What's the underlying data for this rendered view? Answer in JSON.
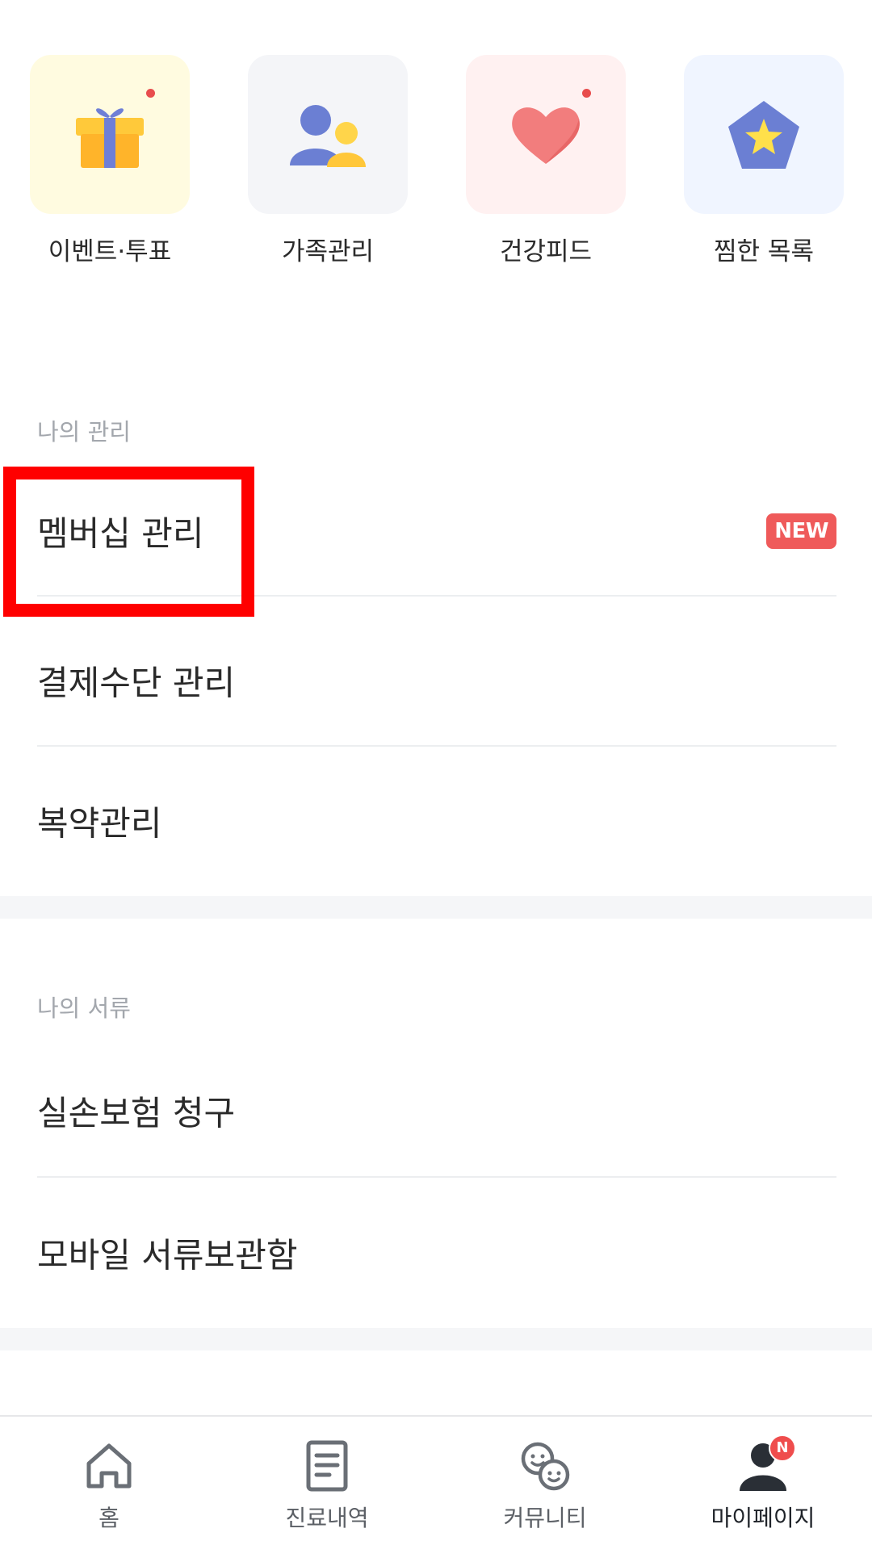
{
  "quick_menu": {
    "items": [
      {
        "label": "이벤트·투표",
        "icon": "gift-icon",
        "tile_color": "#fffbe0",
        "has_dot": true
      },
      {
        "label": "가족관리",
        "icon": "family-icon",
        "tile_color": "#f4f5f8",
        "has_dot": false
      },
      {
        "label": "건강피드",
        "icon": "heart-icon",
        "tile_color": "#fff1f1",
        "has_dot": true
      },
      {
        "label": "찜한 목록",
        "icon": "star-pentagon-icon",
        "tile_color": "#f0f5ff",
        "has_dot": false
      }
    ],
    "dot_color": "#e84d4d"
  },
  "my_management": {
    "section_label": "나의 관리",
    "items": [
      {
        "label": "멤버십 관리",
        "badge": "NEW"
      },
      {
        "label": "결제수단 관리"
      },
      {
        "label": "복약관리"
      }
    ]
  },
  "my_documents": {
    "section_label": "나의 서류",
    "items": [
      {
        "label": "실손보험 청구"
      },
      {
        "label": "모바일 서류보관함"
      }
    ]
  },
  "bottom_nav": {
    "items": [
      {
        "label": "홈",
        "icon": "home-icon",
        "active": false
      },
      {
        "label": "진료내역",
        "icon": "document-icon",
        "active": false
      },
      {
        "label": "커뮤니티",
        "icon": "community-faces-icon",
        "active": false
      },
      {
        "label": "마이페이지",
        "icon": "profile-icon",
        "active": true,
        "badge": "N"
      }
    ]
  },
  "colors": {
    "accent_red": "#ef5a5a",
    "highlight": "#ff0000",
    "section_gap": "#f5f6f8"
  }
}
